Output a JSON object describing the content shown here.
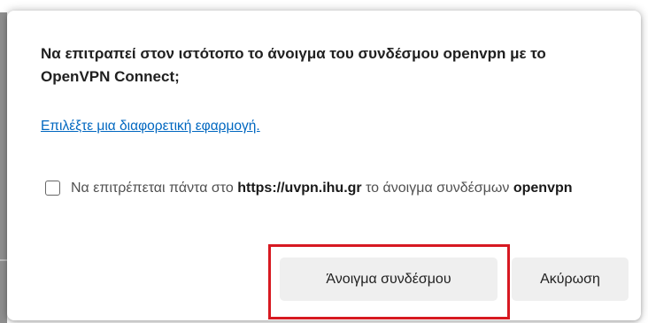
{
  "dialog": {
    "title": "Να επιτραπεί στον ιστότοπο το άνοιγμα του συνδέσμου openvpn με το OpenVPN Connect;",
    "alt_app_link": "Επιλέξτε μια διαφορετική εφαρμογή.",
    "checkbox": {
      "checked": false,
      "text_part1": "Να επιτρέπεται πάντα στο ",
      "site": "https://uvpn.ihu.gr",
      "text_part2": " το άνοιγμα συνδέσμων ",
      "protocol": "openvpn"
    },
    "buttons": {
      "open_link": "Άνοιγμα συνδέσμου",
      "cancel": "Ακύρωση"
    }
  },
  "annotation": {
    "highlight_color": "#d71921",
    "highlighted": "open_link"
  }
}
